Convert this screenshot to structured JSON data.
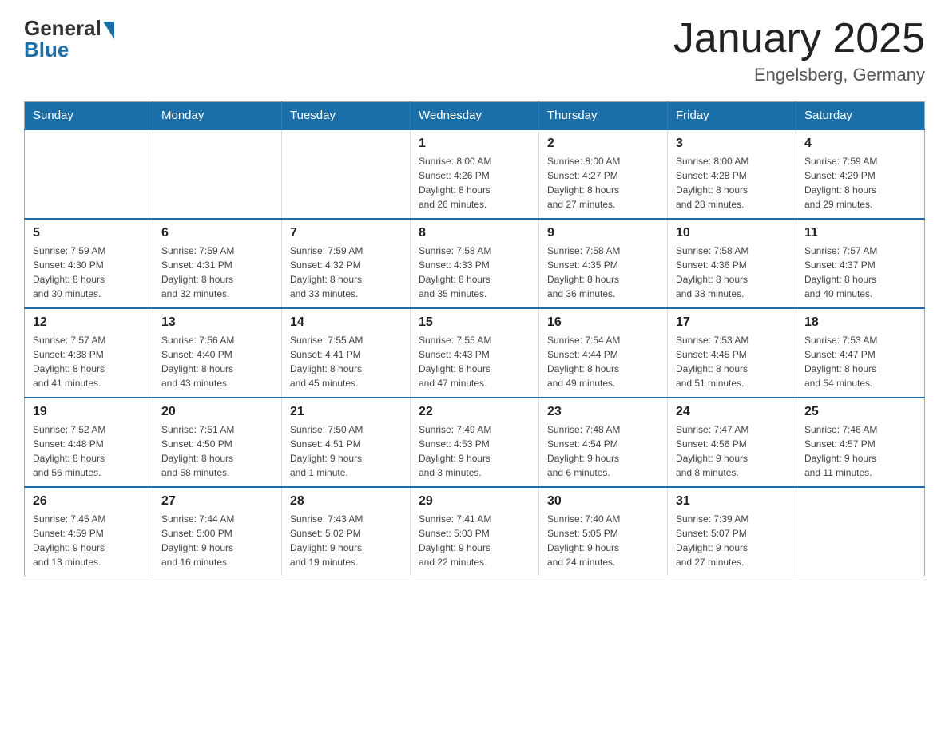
{
  "logo": {
    "general": "General",
    "blue": "Blue"
  },
  "header": {
    "title": "January 2025",
    "location": "Engelsberg, Germany"
  },
  "days_of_week": [
    "Sunday",
    "Monday",
    "Tuesday",
    "Wednesday",
    "Thursday",
    "Friday",
    "Saturday"
  ],
  "weeks": [
    [
      {
        "day": "",
        "info": ""
      },
      {
        "day": "",
        "info": ""
      },
      {
        "day": "",
        "info": ""
      },
      {
        "day": "1",
        "info": "Sunrise: 8:00 AM\nSunset: 4:26 PM\nDaylight: 8 hours\nand 26 minutes."
      },
      {
        "day": "2",
        "info": "Sunrise: 8:00 AM\nSunset: 4:27 PM\nDaylight: 8 hours\nand 27 minutes."
      },
      {
        "day": "3",
        "info": "Sunrise: 8:00 AM\nSunset: 4:28 PM\nDaylight: 8 hours\nand 28 minutes."
      },
      {
        "day": "4",
        "info": "Sunrise: 7:59 AM\nSunset: 4:29 PM\nDaylight: 8 hours\nand 29 minutes."
      }
    ],
    [
      {
        "day": "5",
        "info": "Sunrise: 7:59 AM\nSunset: 4:30 PM\nDaylight: 8 hours\nand 30 minutes."
      },
      {
        "day": "6",
        "info": "Sunrise: 7:59 AM\nSunset: 4:31 PM\nDaylight: 8 hours\nand 32 minutes."
      },
      {
        "day": "7",
        "info": "Sunrise: 7:59 AM\nSunset: 4:32 PM\nDaylight: 8 hours\nand 33 minutes."
      },
      {
        "day": "8",
        "info": "Sunrise: 7:58 AM\nSunset: 4:33 PM\nDaylight: 8 hours\nand 35 minutes."
      },
      {
        "day": "9",
        "info": "Sunrise: 7:58 AM\nSunset: 4:35 PM\nDaylight: 8 hours\nand 36 minutes."
      },
      {
        "day": "10",
        "info": "Sunrise: 7:58 AM\nSunset: 4:36 PM\nDaylight: 8 hours\nand 38 minutes."
      },
      {
        "day": "11",
        "info": "Sunrise: 7:57 AM\nSunset: 4:37 PM\nDaylight: 8 hours\nand 40 minutes."
      }
    ],
    [
      {
        "day": "12",
        "info": "Sunrise: 7:57 AM\nSunset: 4:38 PM\nDaylight: 8 hours\nand 41 minutes."
      },
      {
        "day": "13",
        "info": "Sunrise: 7:56 AM\nSunset: 4:40 PM\nDaylight: 8 hours\nand 43 minutes."
      },
      {
        "day": "14",
        "info": "Sunrise: 7:55 AM\nSunset: 4:41 PM\nDaylight: 8 hours\nand 45 minutes."
      },
      {
        "day": "15",
        "info": "Sunrise: 7:55 AM\nSunset: 4:43 PM\nDaylight: 8 hours\nand 47 minutes."
      },
      {
        "day": "16",
        "info": "Sunrise: 7:54 AM\nSunset: 4:44 PM\nDaylight: 8 hours\nand 49 minutes."
      },
      {
        "day": "17",
        "info": "Sunrise: 7:53 AM\nSunset: 4:45 PM\nDaylight: 8 hours\nand 51 minutes."
      },
      {
        "day": "18",
        "info": "Sunrise: 7:53 AM\nSunset: 4:47 PM\nDaylight: 8 hours\nand 54 minutes."
      }
    ],
    [
      {
        "day": "19",
        "info": "Sunrise: 7:52 AM\nSunset: 4:48 PM\nDaylight: 8 hours\nand 56 minutes."
      },
      {
        "day": "20",
        "info": "Sunrise: 7:51 AM\nSunset: 4:50 PM\nDaylight: 8 hours\nand 58 minutes."
      },
      {
        "day": "21",
        "info": "Sunrise: 7:50 AM\nSunset: 4:51 PM\nDaylight: 9 hours\nand 1 minute."
      },
      {
        "day": "22",
        "info": "Sunrise: 7:49 AM\nSunset: 4:53 PM\nDaylight: 9 hours\nand 3 minutes."
      },
      {
        "day": "23",
        "info": "Sunrise: 7:48 AM\nSunset: 4:54 PM\nDaylight: 9 hours\nand 6 minutes."
      },
      {
        "day": "24",
        "info": "Sunrise: 7:47 AM\nSunset: 4:56 PM\nDaylight: 9 hours\nand 8 minutes."
      },
      {
        "day": "25",
        "info": "Sunrise: 7:46 AM\nSunset: 4:57 PM\nDaylight: 9 hours\nand 11 minutes."
      }
    ],
    [
      {
        "day": "26",
        "info": "Sunrise: 7:45 AM\nSunset: 4:59 PM\nDaylight: 9 hours\nand 13 minutes."
      },
      {
        "day": "27",
        "info": "Sunrise: 7:44 AM\nSunset: 5:00 PM\nDaylight: 9 hours\nand 16 minutes."
      },
      {
        "day": "28",
        "info": "Sunrise: 7:43 AM\nSunset: 5:02 PM\nDaylight: 9 hours\nand 19 minutes."
      },
      {
        "day": "29",
        "info": "Sunrise: 7:41 AM\nSunset: 5:03 PM\nDaylight: 9 hours\nand 22 minutes."
      },
      {
        "day": "30",
        "info": "Sunrise: 7:40 AM\nSunset: 5:05 PM\nDaylight: 9 hours\nand 24 minutes."
      },
      {
        "day": "31",
        "info": "Sunrise: 7:39 AM\nSunset: 5:07 PM\nDaylight: 9 hours\nand 27 minutes."
      },
      {
        "day": "",
        "info": ""
      }
    ]
  ]
}
